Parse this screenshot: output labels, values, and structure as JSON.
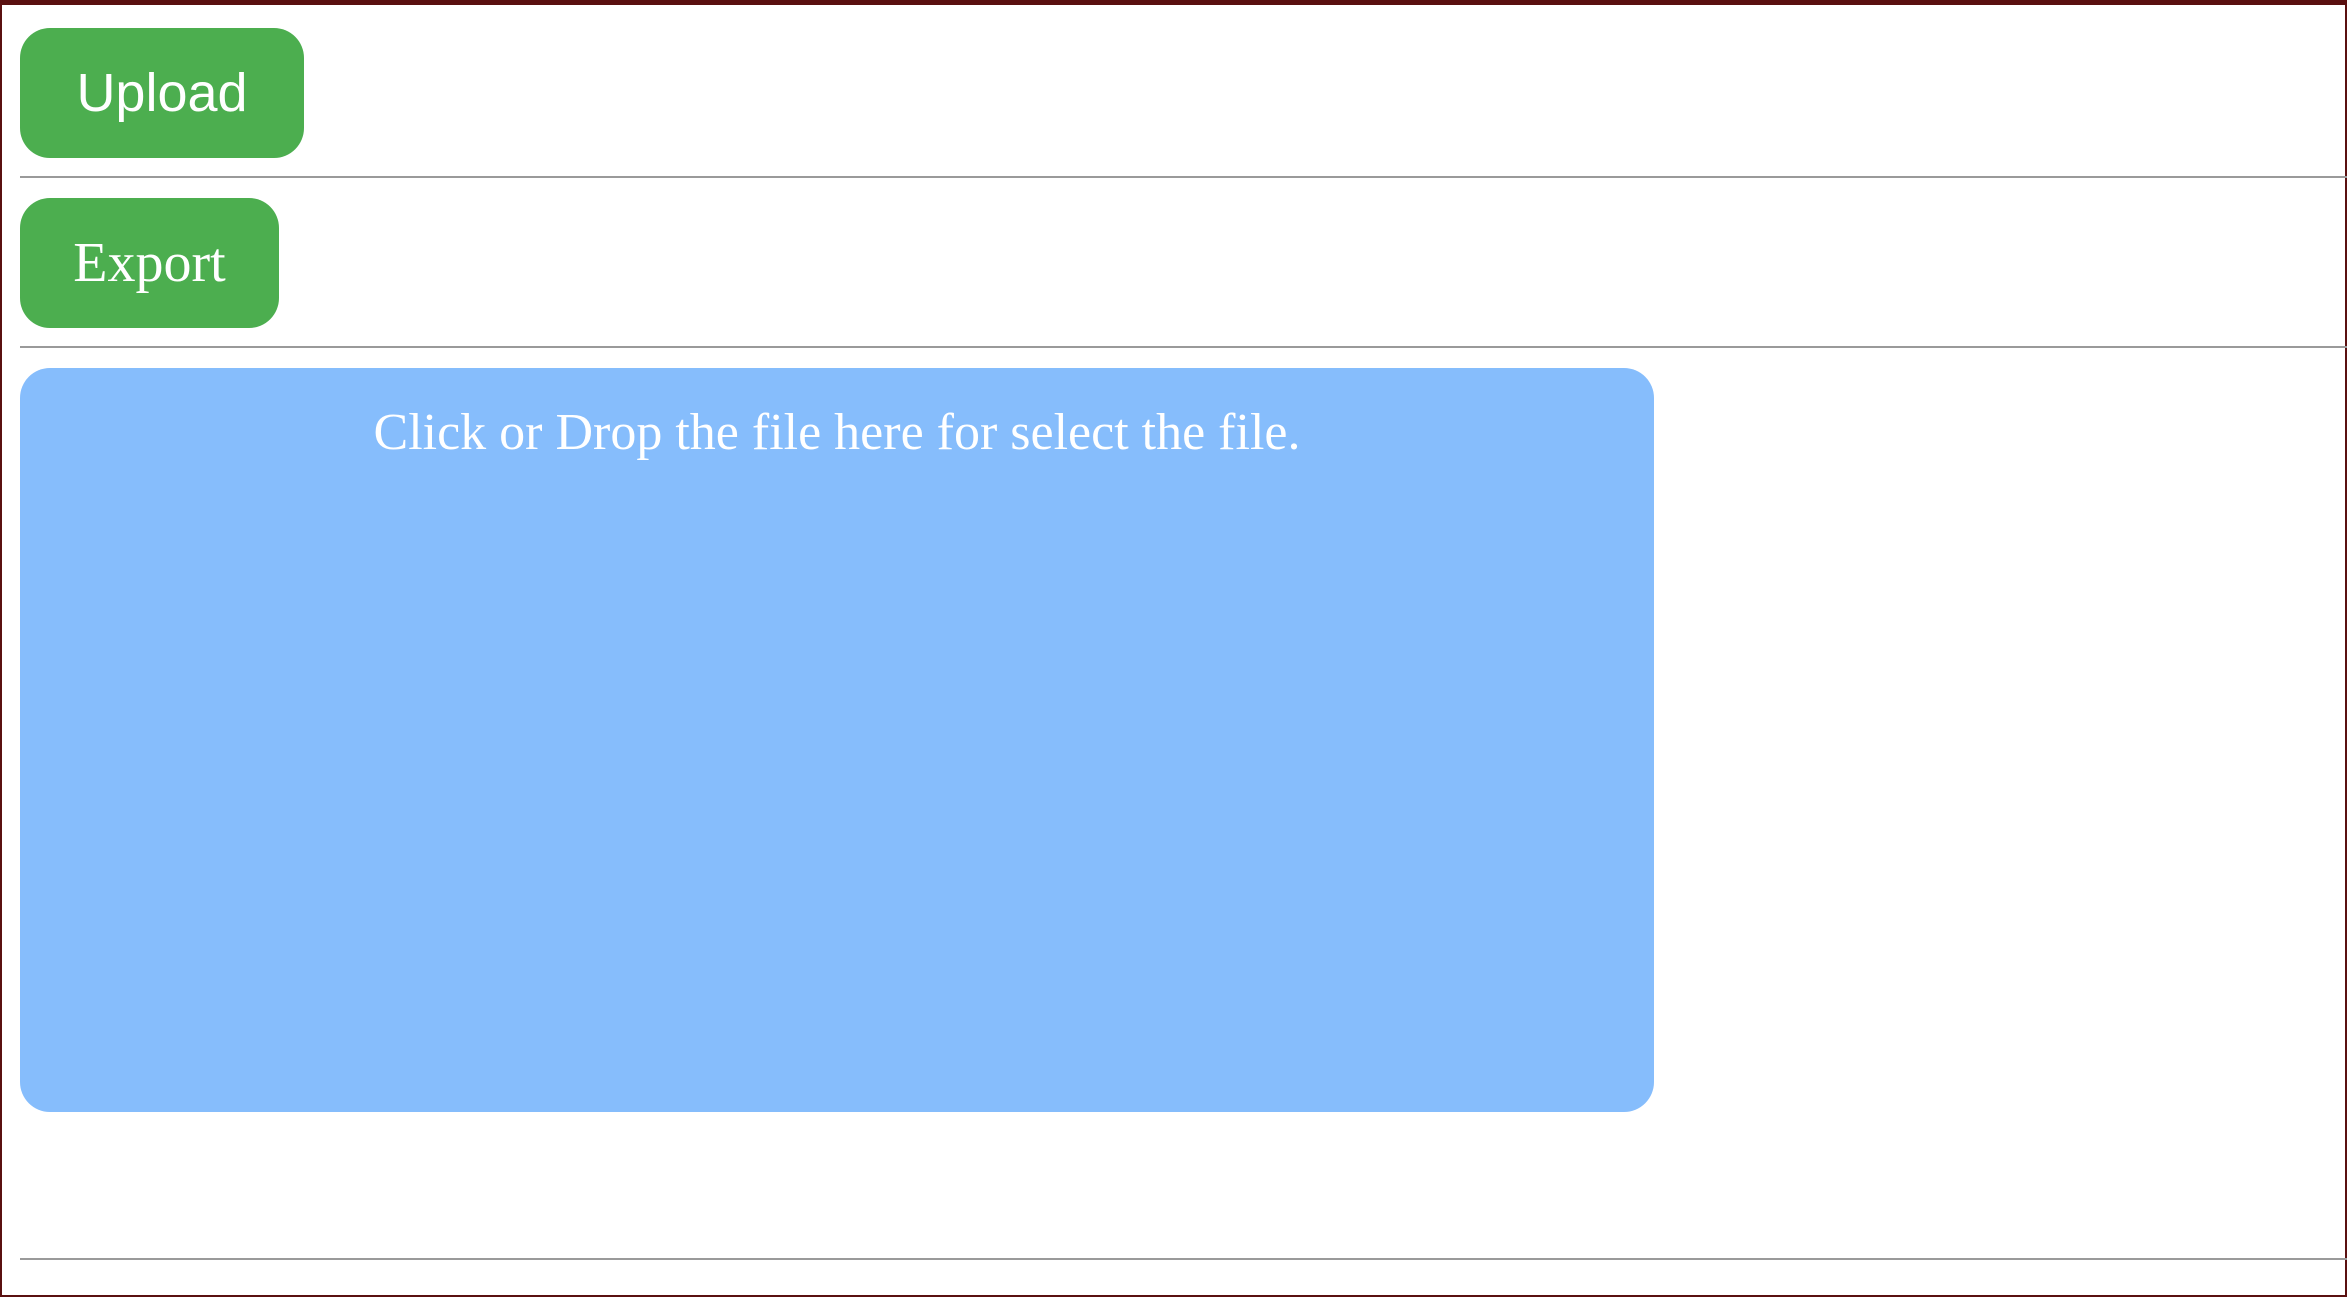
{
  "toolbar": {
    "upload_label": "Upload",
    "export_label": "Export"
  },
  "dropzone": {
    "text": "Click or Drop the file here for select the file."
  },
  "colors": {
    "button_bg": "#4cae4f",
    "dropzone_bg": "#86bdfc",
    "frame_border": "#5a1010",
    "divider": "#9a9a9a"
  }
}
